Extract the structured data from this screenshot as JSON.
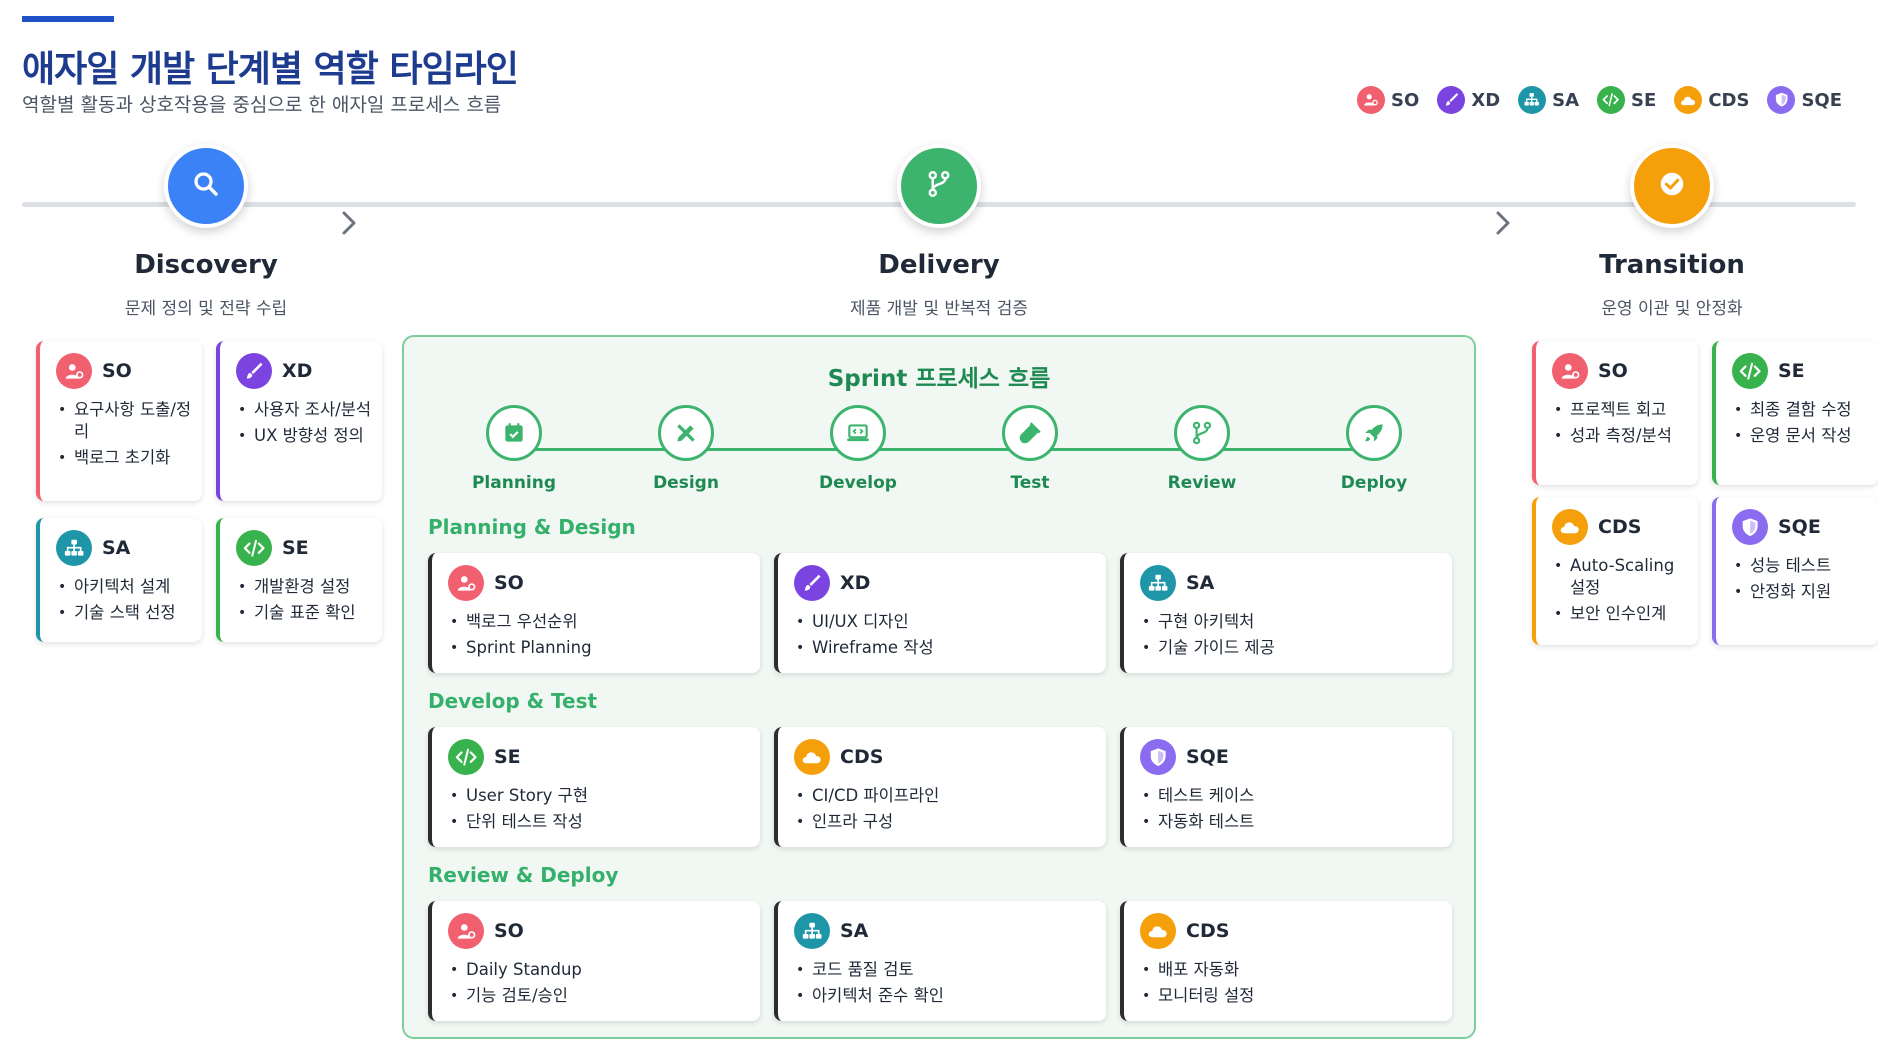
{
  "header": {
    "title": "애자일 개발 단계별 역할 타임라인",
    "subtitle": "역할별 활동과 상호작용을 중심으로 한 애자일 프로세스 흐름"
  },
  "colors": {
    "SO": "#f0606f",
    "XD": "#7b44e0",
    "SA": "#1e96a8",
    "SE": "#37b24d",
    "CDS": "#f59f0a",
    "SQE": "#8b6cf0",
    "discovery": "#3b82f6",
    "delivery": "#3db46d",
    "transition": "#f59f0a"
  },
  "legend": [
    {
      "label": "SO",
      "icon": "user-gear-icon"
    },
    {
      "label": "XD",
      "icon": "brush-icon"
    },
    {
      "label": "SA",
      "icon": "sitemap-icon"
    },
    {
      "label": "SE",
      "icon": "code-icon"
    },
    {
      "label": "CDS",
      "icon": "cloud-icon"
    },
    {
      "label": "SQE",
      "icon": "shield-icon"
    }
  ],
  "phases": {
    "discovery": {
      "title": "Discovery",
      "subtitle": "문제 정의 및 전략 수립",
      "icon": "search-icon",
      "cards": [
        {
          "role": "SO",
          "items": [
            "요구사항 도출/정리",
            "백로그 초기화"
          ]
        },
        {
          "role": "XD",
          "items": [
            "사용자 조사/분석",
            "UX 방향성 정의"
          ]
        },
        {
          "role": "SA",
          "items": [
            "아키텍처 설계",
            "기술 스택 선정"
          ]
        },
        {
          "role": "SE",
          "items": [
            "개발환경 설정",
            "기술 표준 확인"
          ]
        }
      ]
    },
    "delivery": {
      "title": "Delivery",
      "subtitle": "제품 개발 및 반복적 검증",
      "icon": "branch-icon"
    },
    "transition": {
      "title": "Transition",
      "subtitle": "운영 이관 및 안정화",
      "icon": "check-circle-icon",
      "cards": [
        {
          "role": "SO",
          "items": [
            "프로젝트 회고",
            "성과 측정/분석"
          ]
        },
        {
          "role": "SE",
          "items": [
            "최종 결함 수정",
            "운영 문서 작성"
          ]
        },
        {
          "role": "CDS",
          "items": [
            "Auto-Scaling 설정",
            "보안 인수인계"
          ]
        },
        {
          "role": "SQE",
          "items": [
            "성능 테스트",
            "안정화 지원"
          ]
        }
      ]
    }
  },
  "sprint": {
    "title": "Sprint 프로세스 흐름",
    "steps": [
      {
        "label": "Planning",
        "icon": "calendar-check-icon"
      },
      {
        "label": "Design",
        "icon": "pencil-ruler-icon"
      },
      {
        "label": "Develop",
        "icon": "laptop-code-icon"
      },
      {
        "label": "Test",
        "icon": "vial-icon"
      },
      {
        "label": "Review",
        "icon": "branch-icon"
      },
      {
        "label": "Deploy",
        "icon": "rocket-icon"
      }
    ],
    "sections": [
      {
        "title": "Planning & Design",
        "cards": [
          {
            "role": "SO",
            "items": [
              "백로그 우선순위",
              "Sprint Planning"
            ]
          },
          {
            "role": "XD",
            "items": [
              "UI/UX 디자인",
              "Wireframe 작성"
            ]
          },
          {
            "role": "SA",
            "items": [
              "구현 아키텍처",
              "기술 가이드 제공"
            ]
          }
        ]
      },
      {
        "title": "Develop & Test",
        "cards": [
          {
            "role": "SE",
            "items": [
              "User Story 구현",
              "단위 테스트 작성"
            ]
          },
          {
            "role": "CDS",
            "items": [
              "CI/CD 파이프라인",
              "인프라 구성"
            ]
          },
          {
            "role": "SQE",
            "items": [
              "테스트 케이스",
              "자동화 테스트"
            ]
          }
        ]
      },
      {
        "title": "Review & Deploy",
        "cards": [
          {
            "role": "SO",
            "items": [
              "Daily Standup",
              "기능 검토/승인"
            ]
          },
          {
            "role": "SA",
            "items": [
              "코드 품질 검토",
              "아키텍처 준수 확인"
            ]
          },
          {
            "role": "CDS",
            "items": [
              "배포 자동화",
              "모니터링 설정"
            ]
          }
        ]
      }
    ]
  }
}
